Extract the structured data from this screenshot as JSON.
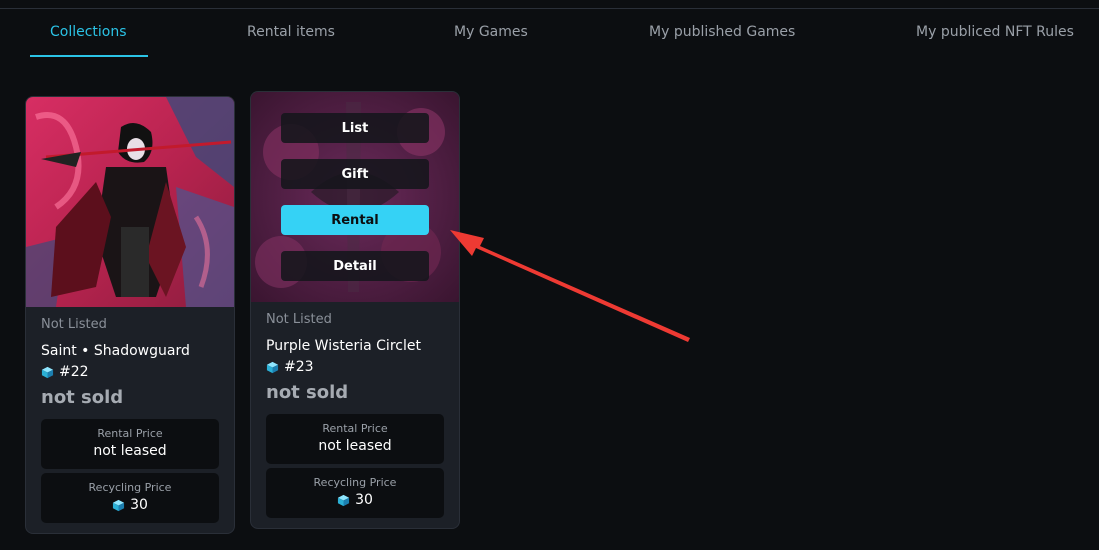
{
  "tabs": [
    {
      "label": "Collections",
      "active": true
    },
    {
      "label": "Rental items"
    },
    {
      "label": "My Games"
    },
    {
      "label": "My published Games"
    },
    {
      "label": "My publiced NFT Rules"
    }
  ],
  "cards": [
    {
      "status": "Not Listed",
      "name": "Saint • Shadowguard",
      "token": "#22",
      "sold": "not sold",
      "rental_label": "Rental Price",
      "rental_value": "not leased",
      "recycling_label": "Recycling Price",
      "recycling_value": "30"
    },
    {
      "status": "Not Listed",
      "name": "Purple Wisteria Circlet",
      "token": "#23",
      "sold": "not sold",
      "rental_label": "Rental Price",
      "rental_value": "not leased",
      "recycling_label": "Recycling Price",
      "recycling_value": "30",
      "menu": [
        "List",
        "Gift",
        "Rental",
        "Detail"
      ]
    }
  ],
  "colors": {
    "accent": "#2bc3e6",
    "rental_button": "#35d2f5",
    "arrow": "#ee3a33",
    "background": "#0c0e11",
    "card": "#1c2027"
  },
  "icons": {
    "token": "cube-icon"
  }
}
